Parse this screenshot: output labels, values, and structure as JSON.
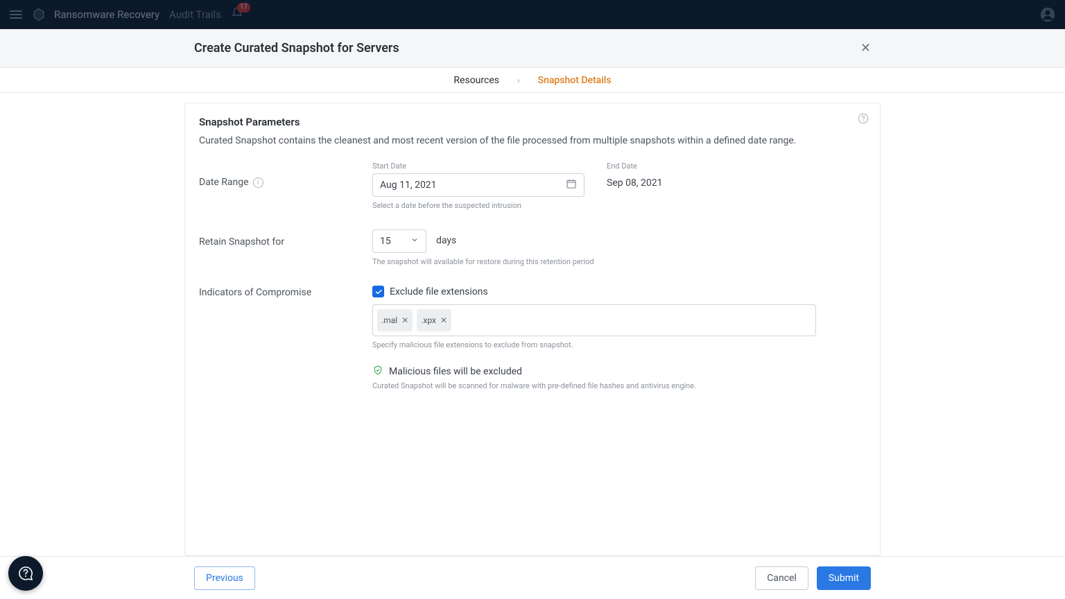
{
  "navbar": {
    "app_title": "Ransomware Recovery",
    "tab_audit": "Audit Trails",
    "notification_count": "17"
  },
  "modal": {
    "title": "Create Curated Snapshot for Servers"
  },
  "wizard": {
    "step1": "Resources",
    "step2": "Snapshot Details"
  },
  "panel": {
    "title": "Snapshot Parameters",
    "desc": "Curated Snapshot contains the cleanest and most recent version of the file processed from multiple snapshots within a defined date range."
  },
  "date_range": {
    "label": "Date Range",
    "start_label": "Start Date",
    "start_value": "Aug 11, 2021",
    "start_hint": "Select a date before the suspected intrusion",
    "end_label": "End Date",
    "end_value": "Sep 08, 2021"
  },
  "retain": {
    "label": "Retain Snapshot for",
    "value": "15",
    "unit": "days",
    "hint": "The snapshot will available for restore during this retention period"
  },
  "ioc": {
    "label": "Indicators of Compromise",
    "checkbox_label": "Exclude file extensions",
    "tags": [
      ".mal",
      ".xpx"
    ],
    "tags_hint": "Specify malicious file extensions to exclude from snapshot.",
    "ok_line": "Malicious files will be excluded",
    "ok_hint": "Curated Snapshot will be scanned for malware with pre-defined file hashes and antivirus engine."
  },
  "footer": {
    "previous": "Previous",
    "cancel": "Cancel",
    "submit": "Submit"
  }
}
